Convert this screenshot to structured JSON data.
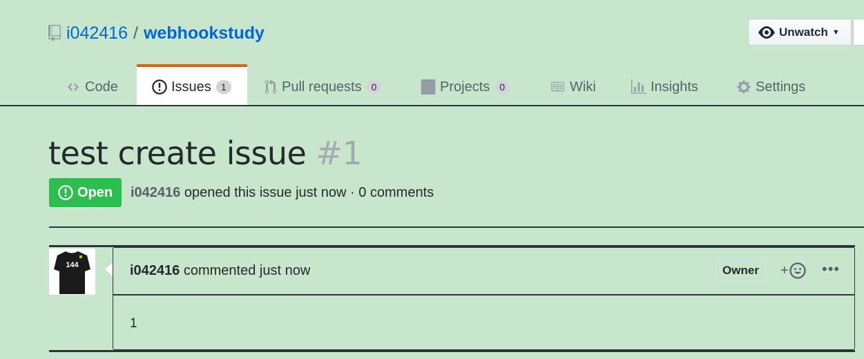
{
  "repo": {
    "owner": "i042416",
    "separator": "/",
    "name": "webhookstudy"
  },
  "watch": {
    "label": "Unwatch",
    "icon": "eye-icon"
  },
  "tabs": [
    {
      "label": "Code",
      "icon": "code-icon"
    },
    {
      "label": "Issues",
      "icon": "issue-opened-icon",
      "count": "1",
      "selected": true
    },
    {
      "label": "Pull requests",
      "icon": "git-pull-request-icon",
      "count": "0"
    },
    {
      "label": "Projects",
      "icon": "project-icon",
      "count": "0"
    },
    {
      "label": "Wiki",
      "icon": "book-icon"
    },
    {
      "label": "Insights",
      "icon": "graph-icon"
    },
    {
      "label": "Settings",
      "icon": "gear-icon"
    }
  ],
  "issue": {
    "title": "test create issue",
    "number": "#1",
    "state": "Open",
    "author": "i042416",
    "meta": "opened this issue just now · 0 comments"
  },
  "comment": {
    "avatar_text": "144",
    "author": "i042416",
    "action": "commented just now",
    "role": "Owner",
    "reaction_label": "+",
    "more_label": "•••",
    "body": "1"
  },
  "colors": {
    "accent": "#0366d6",
    "open": "#2cbe4e",
    "tab_active": "#e36209",
    "background": "#c8e6cc"
  }
}
